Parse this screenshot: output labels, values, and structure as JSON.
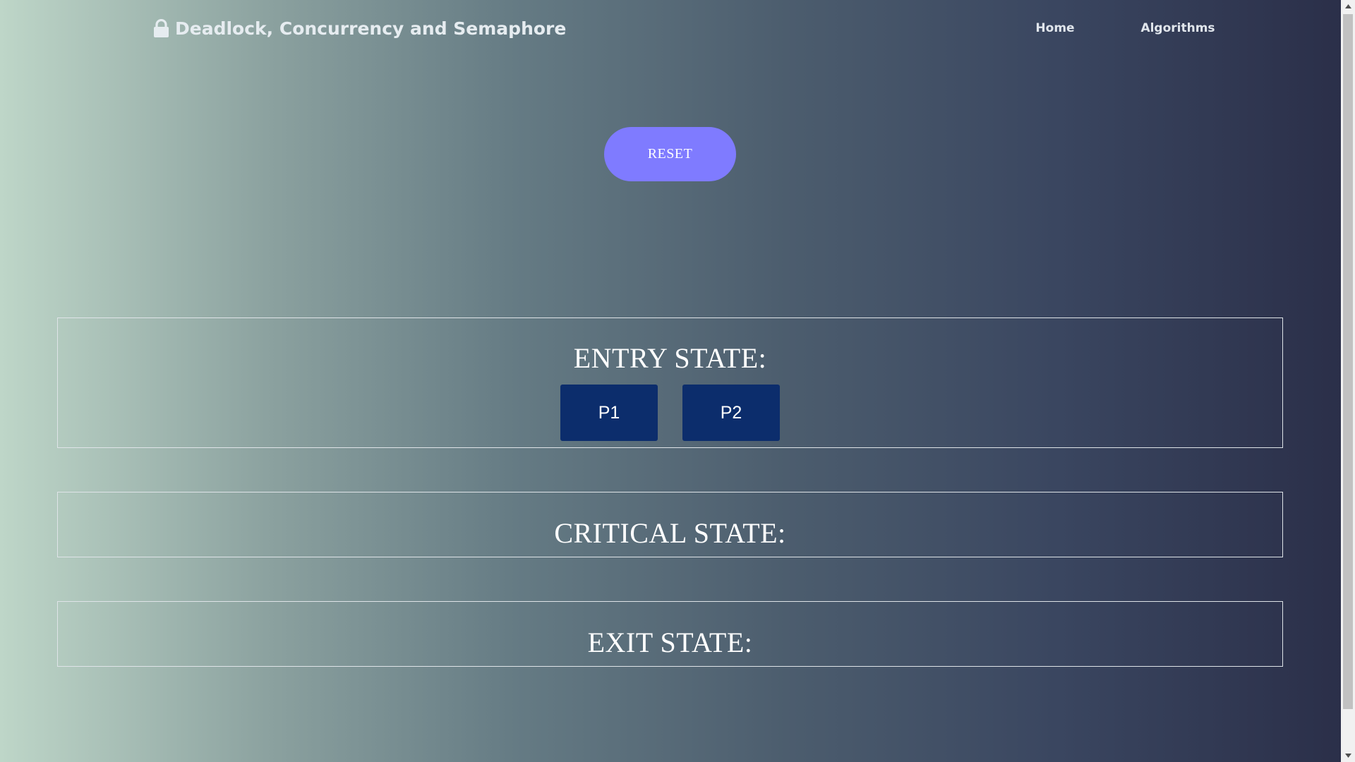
{
  "header": {
    "brand_icon": "lock-icon",
    "brand_title": "Deadlock, Concurrency and Semaphore",
    "nav": [
      {
        "label": "Home"
      },
      {
        "label": "Algorithms"
      }
    ]
  },
  "controls": {
    "reset_label": "RESET"
  },
  "states": {
    "entry": {
      "title": "ENTRY STATE:",
      "processes": [
        "P1",
        "P2"
      ]
    },
    "critical": {
      "title": "CRITICAL STATE:"
    },
    "exit": {
      "title": "EXIT STATE:"
    }
  },
  "colors": {
    "reset_button": "#7f7bff",
    "process_box": "#0c2d6c",
    "gradient_start": "#bed6c8",
    "gradient_end": "#2a2e48"
  }
}
